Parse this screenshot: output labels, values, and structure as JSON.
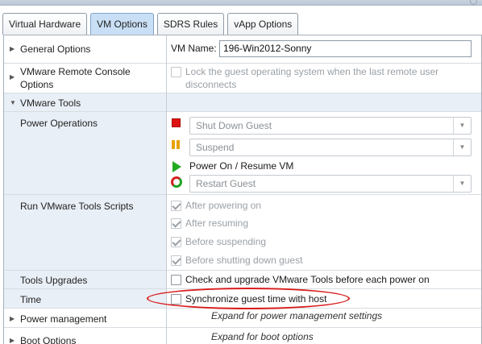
{
  "tabs": [
    {
      "label": "Virtual Hardware",
      "active": false
    },
    {
      "label": "VM Options",
      "active": true
    },
    {
      "label": "SDRS Rules",
      "active": false
    },
    {
      "label": "vApp Options",
      "active": false
    }
  ],
  "general": {
    "label": "General Options",
    "vm_name_label": "VM Name:",
    "vm_name_value": "196-Win2012-Sonny"
  },
  "vmrc": {
    "label_line1": "VMware Remote Console",
    "label_line2": "Options",
    "lock_line1": "Lock the guest operating system when the last remote user",
    "lock_line2": "disconnects"
  },
  "tools": {
    "label": "VMware Tools",
    "power_ops_label": "Power Operations",
    "shutdown_value": "Shut Down Guest",
    "suspend_value": "Suspend",
    "power_on_text": "Power On / Resume VM",
    "restart_value": "Restart Guest",
    "scripts_label": "Run VMware Tools Scripts",
    "scripts": [
      "After powering on",
      "After resuming",
      "Before suspending",
      "Before shutting down guest"
    ],
    "upgrades_label": "Tools Upgrades",
    "upgrades_text": "Check and upgrade VMware Tools before each power on",
    "time_label": "Time",
    "time_text": "Synchronize guest time with host"
  },
  "power_mgmt": {
    "label": "Power management",
    "hint": "Expand for power management settings"
  },
  "boot": {
    "label": "Boot Options",
    "hint": "Expand for boot options"
  },
  "colors": {
    "stop": "#dd1111",
    "pause": "#e8a000",
    "play": "#22aa22",
    "highlight_ellipse": "#d81e1e"
  }
}
